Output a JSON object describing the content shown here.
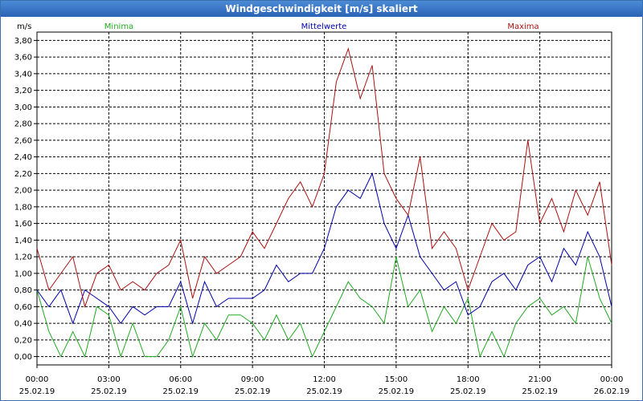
{
  "window": {
    "title": "Windgeschwindigkeit [m/s] skaliert"
  },
  "chart_data": {
    "type": "line",
    "title": "Windgeschwindigkeit [m/s] skaliert",
    "ylabel": "m/s",
    "xlabel": "",
    "ylim": [
      -0.1,
      3.9
    ],
    "xlim": [
      0,
      24
    ],
    "grid": true,
    "y_ticks": [
      "0,00",
      "0,20",
      "0,40",
      "0,60",
      "0,80",
      "1,00",
      "1,20",
      "1,40",
      "1,60",
      "1,80",
      "2,00",
      "2,20",
      "2,40",
      "2,60",
      "2,80",
      "3,00",
      "3,20",
      "3,40",
      "3,60",
      "3,80"
    ],
    "y_tick_values": [
      0,
      0.2,
      0.4,
      0.6,
      0.8,
      1.0,
      1.2,
      1.4,
      1.6,
      1.8,
      2.0,
      2.2,
      2.4,
      2.6,
      2.8,
      3.0,
      3.2,
      3.4,
      3.6,
      3.8
    ],
    "x_ticks": [
      {
        "time": "00:00",
        "date": "25.02.19"
      },
      {
        "time": "03:00",
        "date": "25.02.19"
      },
      {
        "time": "06:00",
        "date": "25.02.19"
      },
      {
        "time": "09:00",
        "date": "25.02.19"
      },
      {
        "time": "12:00",
        "date": "25.02.19"
      },
      {
        "time": "15:00",
        "date": "25.02.19"
      },
      {
        "time": "18:00",
        "date": "25.02.19"
      },
      {
        "time": "21:00",
        "date": "25.02.19"
      },
      {
        "time": "00:00",
        "date": "26.02.19"
      }
    ],
    "x_tick_values": [
      0,
      3,
      6,
      9,
      12,
      15,
      18,
      21,
      24
    ],
    "series": [
      {
        "name": "Minima",
        "color": "#22aa22",
        "legend_position": "left",
        "x": [
          0,
          0.5,
          1,
          1.5,
          2,
          2.5,
          3,
          3.5,
          4,
          4.5,
          5,
          5.5,
          6,
          6.5,
          7,
          7.5,
          8,
          8.5,
          9,
          9.5,
          10,
          10.5,
          11,
          11.5,
          12,
          12.5,
          13,
          13.5,
          14,
          14.5,
          15,
          15.5,
          16,
          16.5,
          17,
          17.5,
          18,
          18.5,
          19,
          19.5,
          20,
          20.5,
          21,
          21.5,
          22,
          22.5,
          23,
          23.5,
          24
        ],
        "values": [
          0.8,
          0.3,
          0,
          0.3,
          0,
          0.6,
          0.5,
          0,
          0.4,
          0,
          0,
          0.2,
          0.6,
          0,
          0.4,
          0.2,
          0.5,
          0.5,
          0.4,
          0.2,
          0.5,
          0.2,
          0.4,
          0,
          0.3,
          0.6,
          0.9,
          0.7,
          0.6,
          0.4,
          1.2,
          0.6,
          0.8,
          0.3,
          0.6,
          0.4,
          0.7,
          0,
          0.3,
          0,
          0.4,
          0.6,
          0.7,
          0.5,
          0.6,
          0.4,
          1.2,
          0.7,
          0.4
        ]
      },
      {
        "name": "Mittelwerte",
        "color": "#0000aa",
        "legend_position": "center",
        "x": [
          0,
          0.5,
          1,
          1.5,
          2,
          2.5,
          3,
          3.5,
          4,
          4.5,
          5,
          5.5,
          6,
          6.5,
          7,
          7.5,
          8,
          8.5,
          9,
          9.5,
          10,
          10.5,
          11,
          11.5,
          12,
          12.5,
          13,
          13.5,
          14,
          14.5,
          15,
          15.5,
          16,
          16.5,
          17,
          17.5,
          18,
          18.5,
          19,
          19.5,
          20,
          20.5,
          21,
          21.5,
          22,
          22.5,
          23,
          23.5,
          24
        ],
        "values": [
          0.8,
          0.6,
          0.8,
          0.4,
          0.8,
          0.7,
          0.6,
          0.4,
          0.6,
          0.5,
          0.6,
          0.6,
          0.9,
          0.4,
          0.9,
          0.6,
          0.7,
          0.7,
          0.7,
          0.8,
          1.1,
          0.9,
          1.0,
          1.0,
          1.3,
          1.8,
          2.0,
          1.9,
          2.2,
          1.6,
          1.3,
          1.7,
          1.2,
          1.0,
          0.8,
          0.9,
          0.5,
          0.6,
          0.9,
          1.0,
          0.8,
          1.1,
          1.2,
          0.9,
          1.3,
          1.1,
          1.5,
          1.2,
          0.6
        ]
      },
      {
        "name": "Maxima",
        "color": "#aa1111",
        "legend_position": "right",
        "x": [
          0,
          0.5,
          1,
          1.5,
          2,
          2.5,
          3,
          3.5,
          4,
          4.5,
          5,
          5.5,
          6,
          6.5,
          7,
          7.5,
          8,
          8.5,
          9,
          9.5,
          10,
          10.5,
          11,
          11.5,
          12,
          12.5,
          13,
          13.5,
          14,
          14.5,
          15,
          15.5,
          16,
          16.5,
          17,
          17.5,
          18,
          18.5,
          19,
          19.5,
          20,
          20.5,
          21,
          21.5,
          22,
          22.5,
          23,
          23.5,
          24
        ],
        "values": [
          1.3,
          0.8,
          1.0,
          1.2,
          0.6,
          1.0,
          1.1,
          0.8,
          0.9,
          0.8,
          1.0,
          1.1,
          1.4,
          0.7,
          1.2,
          1.0,
          1.1,
          1.2,
          1.5,
          1.3,
          1.6,
          1.9,
          2.1,
          1.8,
          2.2,
          3.3,
          3.7,
          3.1,
          3.5,
          2.2,
          1.9,
          1.7,
          2.4,
          1.3,
          1.5,
          1.3,
          0.8,
          1.2,
          1.6,
          1.4,
          1.5,
          2.6,
          1.6,
          1.9,
          1.5,
          2.0,
          1.7,
          2.1,
          1.1
        ]
      }
    ]
  }
}
